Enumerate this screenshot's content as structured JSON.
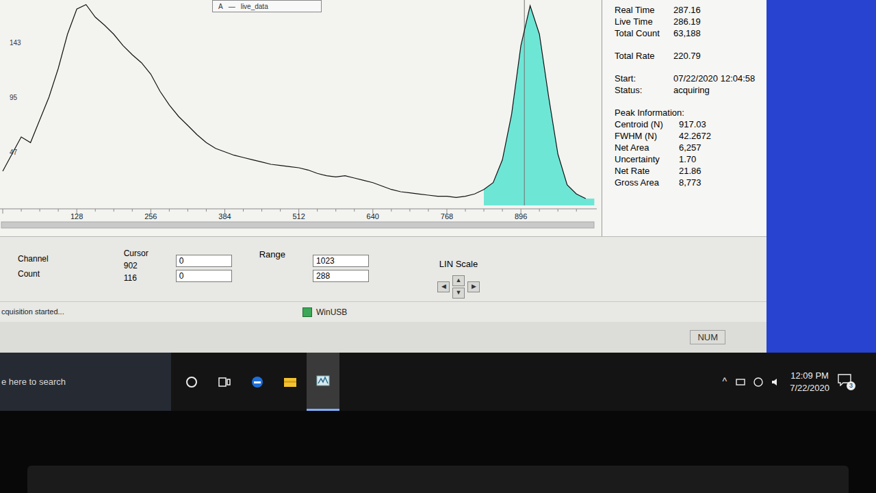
{
  "chart": {
    "legend": {
      "letter": "A",
      "dash": "—",
      "label": "live_data"
    },
    "y_ticks": [
      "143",
      "95",
      "47"
    ],
    "x_ticks": [
      "128",
      "256",
      "384",
      "512",
      "640",
      "768",
      "896"
    ],
    "series": [
      {
        "name": "live_data",
        "channel_step": 16,
        "values": [
          30,
          45,
          60,
          55,
          75,
          95,
          120,
          150,
          172,
          176,
          165,
          158,
          150,
          140,
          132,
          125,
          115,
          100,
          88,
          78,
          70,
          62,
          55,
          50,
          47,
          44,
          42,
          40,
          38,
          36,
          35,
          34,
          33,
          31,
          28,
          26,
          25,
          26,
          24,
          22,
          20,
          17,
          14,
          12,
          11,
          10,
          9,
          8,
          8,
          7,
          8,
          10,
          14,
          20,
          40,
          80,
          140,
          175,
          150,
          95,
          45,
          18,
          10,
          6
        ]
      }
    ],
    "roi": {
      "start_channel": 832,
      "end_channel": 1023,
      "color": "#6ee6d6"
    }
  },
  "info": {
    "groups": [
      {
        "title": "",
        "rows": [
          {
            "label": "Real Time",
            "value": "287.16"
          },
          {
            "label": "Live Time",
            "value": "286.19"
          },
          {
            "label": "Total Count",
            "value": "63,188"
          }
        ]
      },
      {
        "title": "",
        "rows": [
          {
            "label": "Total Rate",
            "value": "220.79"
          }
        ]
      },
      {
        "title": "",
        "rows": [
          {
            "label": "Start:",
            "value": "07/22/2020 12:04:58"
          },
          {
            "label": "Status:",
            "value": "acquiring"
          }
        ]
      },
      {
        "title": "Peak Information:",
        "rows": [
          {
            "label": "Centroid (N)",
            "value": "917.03"
          },
          {
            "label": "FWHM (N)",
            "value": "42.2672"
          },
          {
            "label": "Net Area",
            "value": "6,257"
          },
          {
            "label": "Uncertainty",
            "value": "1.70"
          },
          {
            "label": "Net Rate",
            "value": "21.86"
          },
          {
            "label": "Gross Area",
            "value": "8,773"
          }
        ]
      }
    ]
  },
  "cursor": {
    "title": "Cursor",
    "labels": [
      "Channel",
      "Count"
    ],
    "values": [
      "902",
      "116"
    ]
  },
  "range": {
    "label": "Range",
    "min_fields": [
      "0",
      "0"
    ],
    "max_fields": [
      "1023",
      "288"
    ]
  },
  "scale": {
    "label": "LIN Scale",
    "buttons": {
      "left": "◀",
      "up": "▲",
      "down": "▼",
      "right": "▶"
    }
  },
  "status_message": "cquisition started...",
  "connection": "WinUSB",
  "keyboard_indicator": "NUM",
  "taskbar": {
    "search_placeholder": "e here to search",
    "apps": [
      {
        "kind": "cortana",
        "active": false
      },
      {
        "kind": "taskview",
        "active": false
      },
      {
        "kind": "edge",
        "active": false
      },
      {
        "kind": "folder",
        "active": false
      },
      {
        "kind": "analyzer",
        "active": true
      }
    ]
  },
  "tray": {
    "chevron": "^",
    "time": "12:09 PM",
    "date": "7/22/2020",
    "notifications": "3"
  }
}
